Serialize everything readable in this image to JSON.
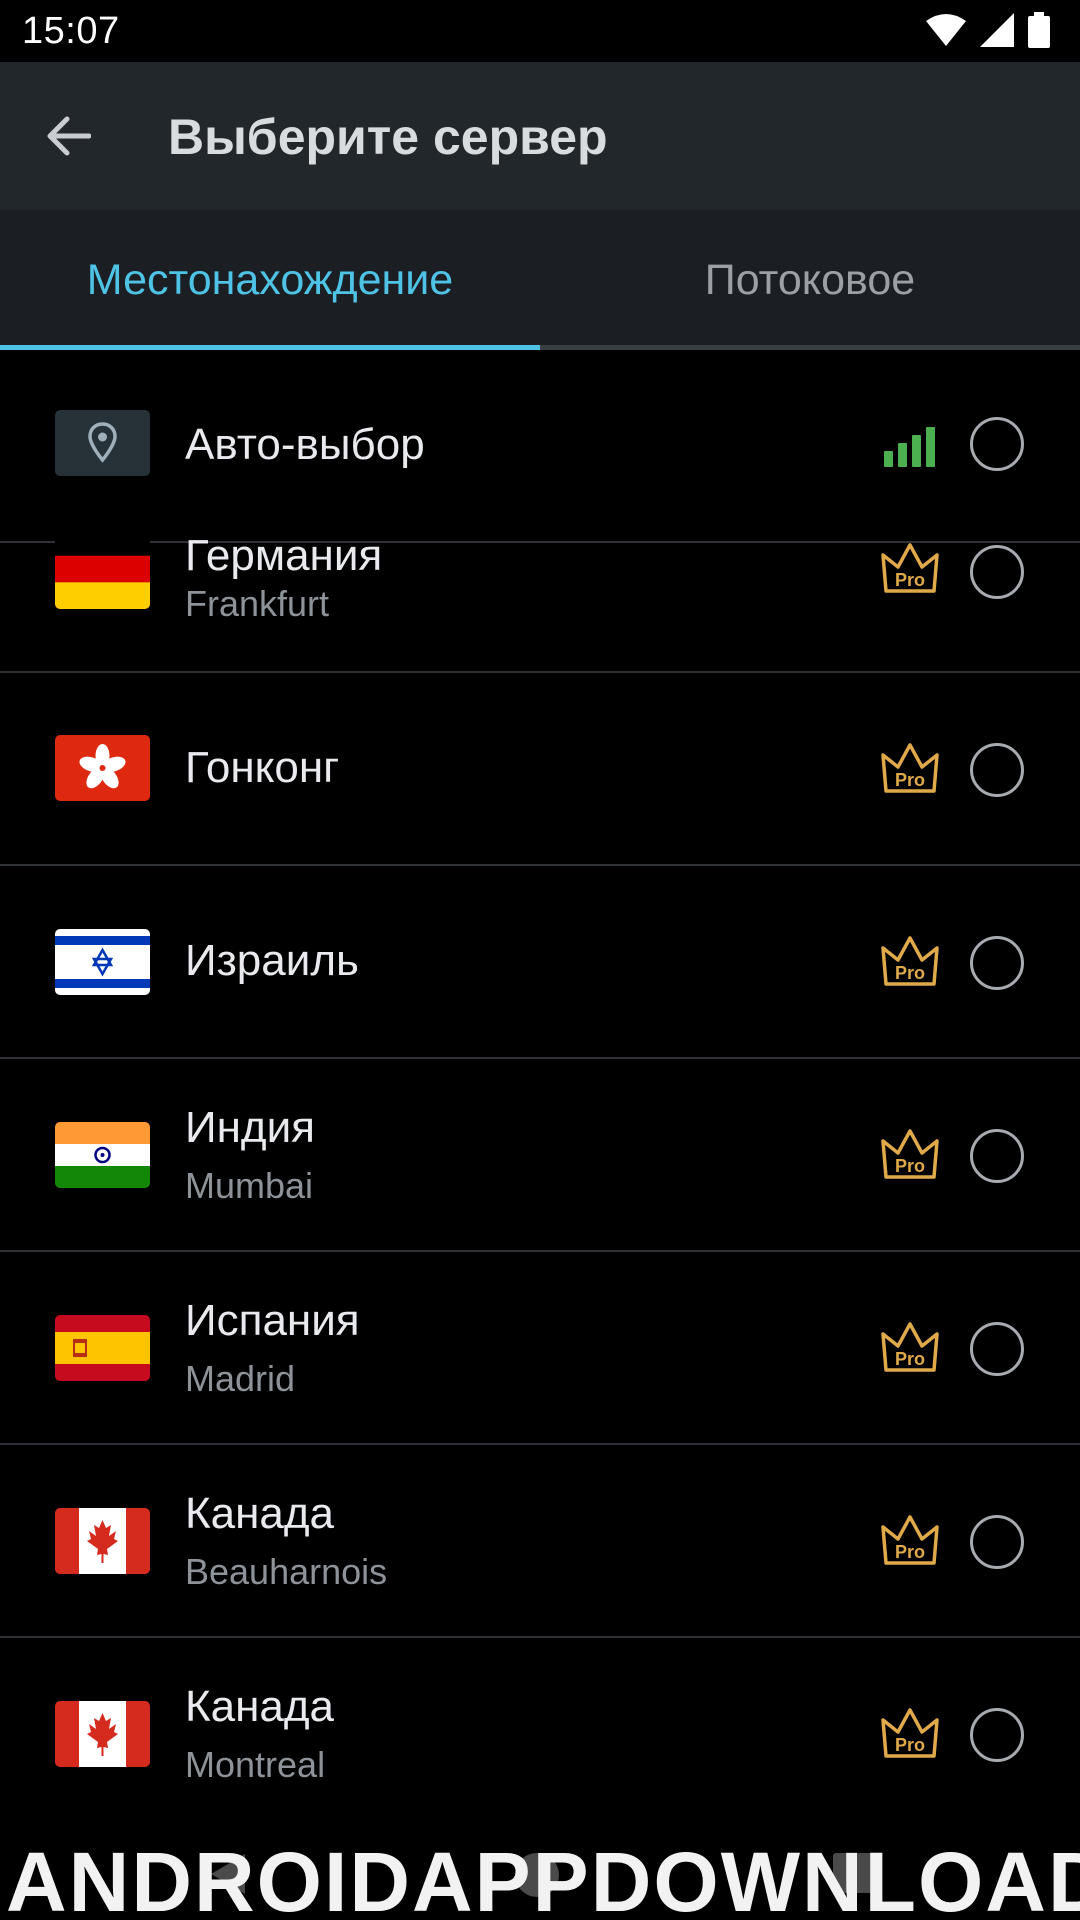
{
  "status_bar": {
    "time": "15:07"
  },
  "app_bar": {
    "title": "Выберите сервер"
  },
  "tabs": [
    {
      "label": "Местонахождение",
      "active": true
    },
    {
      "label": "Потоковое",
      "active": false
    }
  ],
  "servers": [
    {
      "country": "Авто-выбор",
      "city": "",
      "flag": "location-pin-icon",
      "badge": "signal-strength-icon"
    },
    {
      "country": "Германия",
      "city": "Frankfurt",
      "flag": "germany-flag-icon",
      "badge": "pro-crown-icon"
    },
    {
      "country": "Гонконг",
      "city": "",
      "flag": "hong-kong-flag-icon",
      "badge": "pro-crown-icon"
    },
    {
      "country": "Израиль",
      "city": "",
      "flag": "israel-flag-icon",
      "badge": "pro-crown-icon"
    },
    {
      "country": "Индия",
      "city": "Mumbai",
      "flag": "india-flag-icon",
      "badge": "pro-crown-icon"
    },
    {
      "country": "Испания",
      "city": "Madrid",
      "flag": "spain-flag-icon",
      "badge": "pro-crown-icon"
    },
    {
      "country": "Канада",
      "city": "Beauharnois",
      "flag": "canada-flag-icon",
      "badge": "pro-crown-icon"
    },
    {
      "country": "Канада",
      "city": "Montreal",
      "flag": "canada-flag-icon",
      "badge": "pro-crown-icon"
    }
  ],
  "pro_label": "Pro",
  "watermark": "ANDROIDAPPDOWNLOAD.L",
  "colors": {
    "accent": "#4fc3e6",
    "pro_gold": "#e0a94a",
    "signal_green": "#4caf50",
    "app_bar": "#22272b",
    "tab_bar": "#1b1f23"
  }
}
